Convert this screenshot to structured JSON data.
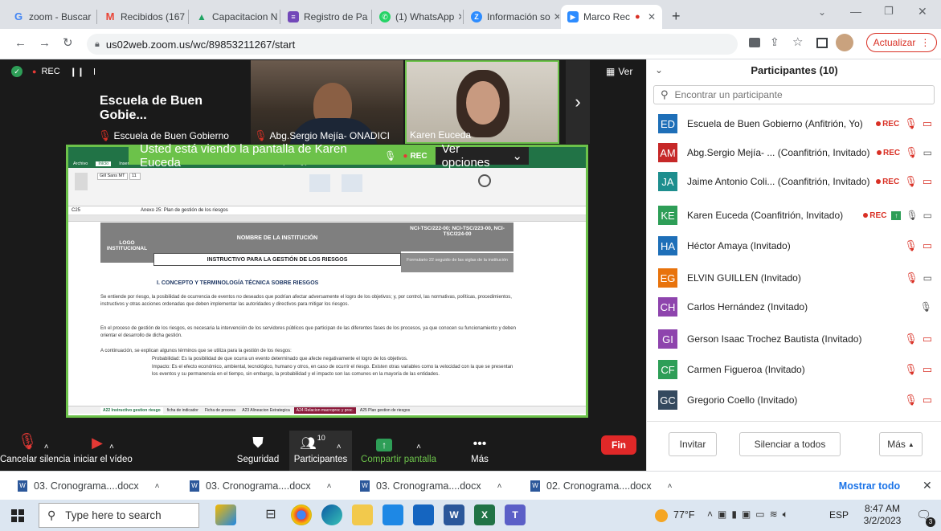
{
  "browser": {
    "tabs": [
      {
        "label": "zoom - Buscar",
        "fav": "G",
        "color": "#4285f4"
      },
      {
        "label": "Recibidos (167",
        "fav": "M",
        "color": "#ea4335"
      },
      {
        "label": "Capacitacion N",
        "fav": "▲",
        "color": "#1fa463"
      },
      {
        "label": "Registro de Pa",
        "fav": "≡",
        "color": "#7248b9"
      },
      {
        "label": "(1) WhatsApp",
        "fav": "●",
        "color": "#25d366"
      },
      {
        "label": "Información so",
        "fav": "Z",
        "color": "#2d8cff"
      },
      {
        "label": "Marco Rec",
        "fav": "▶",
        "color": "#2d8cff"
      }
    ],
    "url": "us02web.zoom.us/wc/89853211267/start",
    "update_label": "Actualizar"
  },
  "meeting": {
    "rec_label": "REC",
    "view_label": "Ver",
    "org_title": "Escuela de Buen Gobie...",
    "tile1_name": "Escuela de Buen Gobierno",
    "tile2_name": "Abg.Sergio Mejía- ONADICI",
    "tile3_name": "Karen Euceda",
    "share_banner": "Usted está viendo la pantalla de Karen Euceda",
    "share_rec": "REC",
    "view_options": "Ver opciones"
  },
  "spreadsheet": {
    "ribbon_tabs": [
      "Archivo",
      "Inicio",
      "Insertar",
      "Disposición de página",
      "Fórmulas",
      "Datos",
      "Revisar",
      "Vista",
      "Ayuda",
      "¿Qué desea hacer?"
    ],
    "font_name": "Gill Sans MT",
    "font_size": "11",
    "cell_ref": "C25",
    "formula": "Anexo 25: Plan de gestión de los riesgos",
    "logo": "LOGO INSTITUCIONAL",
    "institution": "NOMBRE DE LA INSTITUCIÓN",
    "codes": "NCI-TSC/222-00; NCI-TSC/223-00, NCI-TSC/224-00",
    "instructivo": "INSTRUCTIVO PARA LA GESTIÓN DE LOS RIESGOS",
    "formulario": "Formulario 22 seguido de las siglas de la institución",
    "section": "I.    CONCEPTO Y TERMINOLOGÍA TÉCNICA SOBRE RIESGOS",
    "p1": "Se entiende por riesgo, la posibilidad de ocurrencia de eventos no deseados que podrían afectar adversamente el logro de los objetivos; y, por control, las normativas, políticas, procedimientos, instructivos y otras acciones ordenadas que deben implementar las autoridades y directivos para mitigar los riesgos.",
    "p2": "En el proceso de gestión de los riesgos, es necesaria la intervención de los servidores públicos que participan de las diferentes fases de los procesos, ya que conocen su funcionamiento y deben orientar el desarrollo de dicha gestión.",
    "p3": "A continuación, se explican algunos términos que se utiliza para la gestión de los riesgos:",
    "p4": "Probabilidad: Es la posibilidad de que ocurra un evento determinado que afecte negativamente el logro de los objetivos.",
    "p5": "Impacto: Es el efecto económico, ambiental, tecnológico, humano y otros, en caso de ocurrir el riesgo. Existen otras variables como la velocidad con la que se presentan los eventos y su permanencia en el tiempo, sin embargo, la probabilidad y el impacto son las comunes en la mayoría de las entidades.",
    "sheet_tabs": [
      "A22 Instructivo gestion riesgo",
      "ficha de indicador",
      "Ficha de proceso",
      "A23 Alineacion Estrategica",
      "A24 Relacion macroproc y proc.",
      "A25 Plan gestion de riesgos"
    ]
  },
  "controls": {
    "unmute": "Cancelar silencia",
    "video": "iniciar el vídeo",
    "security": "Seguridad",
    "participants": "Participantes",
    "participants_count": "10",
    "share": "Compartir pantalla",
    "more": "Más",
    "end": "Fin"
  },
  "panel": {
    "title": "Participantes (10)",
    "search_placeholder": "Encontrar un participante",
    "participants": [
      {
        "initials": "ED",
        "name": "Escuela de Buen Gobierno (Anfitrión, Yo)",
        "color": "#1e6fb8",
        "rec": "REC"
      },
      {
        "initials": "AM",
        "name": "Abg.Sergio Mejía- ...  (Coanfitrión, Invitado)",
        "color": "#c62828",
        "rec": "REC"
      },
      {
        "initials": "JA",
        "name": "Jaime Antonio Coli... (Coanfitrión, Invitado)",
        "color": "#1e8e8e",
        "rec": "REC"
      },
      {
        "initials": "KE",
        "name": "Karen Euceda (Coanfitrión, Invitado)",
        "color": "#2e9e57",
        "rec": "REC"
      },
      {
        "initials": "HA",
        "name": "Héctor Amaya (Invitado)",
        "color": "#1e6fb8",
        "rec": ""
      },
      {
        "initials": "EG",
        "name": "ELVIN GUILLEN (Invitado)",
        "color": "#e8730c",
        "rec": ""
      },
      {
        "initials": "CH",
        "name": "Carlos Hernández (Invitado)",
        "color": "#8e44ad",
        "rec": ""
      },
      {
        "initials": "GI",
        "name": "Gerson Isaac Trochez Bautista (Invitado)",
        "color": "#8e44ad",
        "rec": ""
      },
      {
        "initials": "CF",
        "name": "Carmen Figueroa (Invitado)",
        "color": "#2e9e57",
        "rec": ""
      },
      {
        "initials": "GC",
        "name": "Gregorio Coello (Invitado)",
        "color": "#34495e",
        "rec": ""
      }
    ],
    "invite": "Invitar",
    "mute_all": "Silenciar a todos",
    "more": "Más"
  },
  "downloads": {
    "items": [
      "03. Cronograma....docx",
      "03. Cronograma....docx",
      "03. Cronograma....docx",
      "02. Cronograma....docx"
    ],
    "show_all": "Mostrar todo"
  },
  "taskbar": {
    "search_placeholder": "Type here to search",
    "temp": "77°F",
    "lang": "ESP",
    "time": "8:47 AM",
    "date": "3/2/2023",
    "notif_count": "3"
  }
}
